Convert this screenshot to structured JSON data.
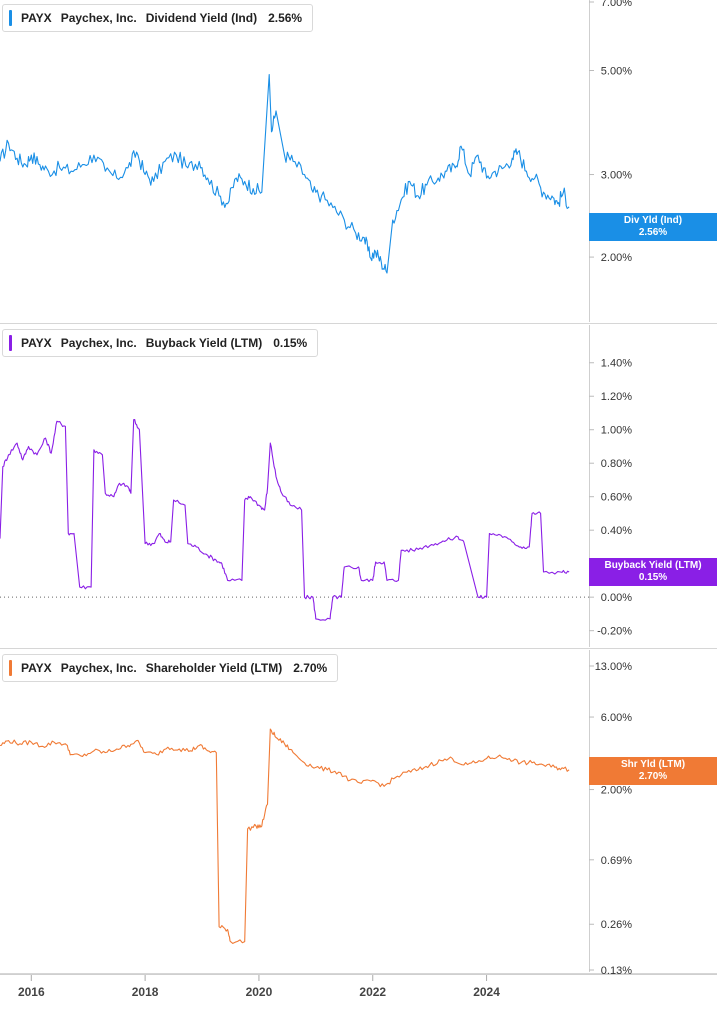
{
  "chart_data": [
    {
      "type": "line",
      "legend": {
        "ticker": "PAYX",
        "company": "Paychex, Inc.",
        "metric": "Dividend Yield (Ind)",
        "value": "2.56%"
      },
      "tag": {
        "label": "Div Yld (Ind)",
        "value": "2.56%"
      },
      "color": "#1a8fe6",
      "scale": "log",
      "ylim": [
        1.62,
        7.0
      ],
      "yticks": [
        {
          "label": "7.00%",
          "v": 7.0
        },
        {
          "label": "5.00%",
          "v": 5.0
        },
        {
          "label": "3.00%",
          "v": 3.0
        },
        {
          "label": "2.00%",
          "v": 2.0
        }
      ],
      "zero_line": false,
      "series": [
        {
          "points": [
            [
              2015.45,
              3.2
            ],
            [
              2015.6,
              3.5
            ],
            [
              2015.75,
              3.25
            ],
            [
              2015.9,
              3.15
            ],
            [
              2016.0,
              3.3
            ],
            [
              2016.15,
              3.15
            ],
            [
              2016.3,
              3.05
            ],
            [
              2016.5,
              3.1
            ],
            [
              2016.7,
              3.05
            ],
            [
              2016.9,
              3.15
            ],
            [
              2017.1,
              3.3
            ],
            [
              2017.3,
              3.05
            ],
            [
              2017.5,
              2.95
            ],
            [
              2017.7,
              3.1
            ],
            [
              2017.85,
              3.35
            ],
            [
              2018.0,
              3.0
            ],
            [
              2018.15,
              2.9
            ],
            [
              2018.35,
              3.2
            ],
            [
              2018.55,
              3.3
            ],
            [
              2018.75,
              3.1
            ],
            [
              2018.95,
              3.2
            ],
            [
              2019.1,
              2.95
            ],
            [
              2019.3,
              2.7
            ],
            [
              2019.45,
              2.6
            ],
            [
              2019.6,
              2.95
            ],
            [
              2019.75,
              2.9
            ],
            [
              2019.9,
              2.8
            ],
            [
              2020.05,
              2.75
            ],
            [
              2020.18,
              4.9
            ],
            [
              2020.22,
              3.7
            ],
            [
              2020.3,
              4.1
            ],
            [
              2020.45,
              3.3
            ],
            [
              2020.6,
              3.2
            ],
            [
              2020.8,
              3.0
            ],
            [
              2020.95,
              2.75
            ],
            [
              2021.1,
              2.7
            ],
            [
              2021.3,
              2.55
            ],
            [
              2021.5,
              2.4
            ],
            [
              2021.7,
              2.25
            ],
            [
              2021.85,
              2.2
            ],
            [
              2021.95,
              2.0
            ],
            [
              2022.05,
              2.05
            ],
            [
              2022.15,
              1.95
            ],
            [
              2022.25,
              1.85
            ],
            [
              2022.35,
              2.4
            ],
            [
              2022.5,
              2.65
            ],
            [
              2022.65,
              2.9
            ],
            [
              2022.8,
              2.7
            ],
            [
              2022.95,
              2.85
            ],
            [
              2023.15,
              2.95
            ],
            [
              2023.3,
              3.05
            ],
            [
              2023.45,
              3.1
            ],
            [
              2023.55,
              3.45
            ],
            [
              2023.7,
              3.0
            ],
            [
              2023.85,
              3.3
            ],
            [
              2024.0,
              2.95
            ],
            [
              2024.15,
              3.05
            ],
            [
              2024.3,
              3.1
            ],
            [
              2024.45,
              3.25
            ],
            [
              2024.55,
              3.35
            ],
            [
              2024.7,
              3.05
            ],
            [
              2024.85,
              2.95
            ],
            [
              2025.0,
              2.75
            ],
            [
              2025.15,
              2.7
            ],
            [
              2025.25,
              2.6
            ],
            [
              2025.35,
              2.75
            ],
            [
              2025.45,
              2.56
            ]
          ]
        }
      ]
    },
    {
      "type": "line",
      "legend": {
        "ticker": "PAYX",
        "company": "Paychex, Inc.",
        "metric": "Buyback Yield (LTM)",
        "value": "0.15%"
      },
      "tag": {
        "label": "Buyback Yield (LTM)",
        "value": "0.15%"
      },
      "color": "#8a1fe6",
      "scale": "linear",
      "ylim": [
        -0.22,
        1.5
      ],
      "yticks": [
        {
          "label": "1.40%",
          "v": 1.4
        },
        {
          "label": "1.20%",
          "v": 1.2
        },
        {
          "label": "1.00%",
          "v": 1.0
        },
        {
          "label": "0.80%",
          "v": 0.8
        },
        {
          "label": "0.60%",
          "v": 0.6
        },
        {
          "label": "0.40%",
          "v": 0.4
        },
        {
          "label": "0.20%",
          "v": 0.2
        },
        {
          "label": "0.00%",
          "v": 0.0
        },
        {
          "label": "-0.20%",
          "v": -0.2
        }
      ],
      "zero_line": true,
      "series": [
        {
          "points": [
            [
              2015.45,
              0.35
            ],
            [
              2015.5,
              0.78
            ],
            [
              2015.6,
              0.85
            ],
            [
              2015.75,
              0.92
            ],
            [
              2015.85,
              0.82
            ],
            [
              2015.95,
              0.9
            ],
            [
              2016.1,
              0.85
            ],
            [
              2016.25,
              0.95
            ],
            [
              2016.35,
              0.86
            ],
            [
              2016.45,
              1.05
            ],
            [
              2016.6,
              1.02
            ],
            [
              2016.65,
              0.38
            ],
            [
              2016.75,
              0.38
            ],
            [
              2016.85,
              0.06
            ],
            [
              2017.05,
              0.06
            ],
            [
              2017.1,
              0.88
            ],
            [
              2017.25,
              0.85
            ],
            [
              2017.3,
              0.62
            ],
            [
              2017.45,
              0.6
            ],
            [
              2017.55,
              0.68
            ],
            [
              2017.7,
              0.66
            ],
            [
              2017.75,
              0.62
            ],
            [
              2017.8,
              1.06
            ],
            [
              2017.9,
              1.0
            ],
            [
              2018.0,
              0.32
            ],
            [
              2018.15,
              0.32
            ],
            [
              2018.25,
              0.38
            ],
            [
              2018.35,
              0.33
            ],
            [
              2018.45,
              0.33
            ],
            [
              2018.5,
              0.58
            ],
            [
              2018.7,
              0.55
            ],
            [
              2018.75,
              0.32
            ],
            [
              2018.9,
              0.3
            ],
            [
              2019.1,
              0.25
            ],
            [
              2019.25,
              0.22
            ],
            [
              2019.35,
              0.2
            ],
            [
              2019.45,
              0.1
            ],
            [
              2019.7,
              0.1
            ],
            [
              2019.75,
              0.58
            ],
            [
              2019.85,
              0.6
            ],
            [
              2020.0,
              0.55
            ],
            [
              2020.1,
              0.52
            ],
            [
              2020.15,
              0.65
            ],
            [
              2020.2,
              0.92
            ],
            [
              2020.3,
              0.72
            ],
            [
              2020.4,
              0.62
            ],
            [
              2020.55,
              0.55
            ],
            [
              2020.75,
              0.52
            ],
            [
              2020.8,
              0.0
            ],
            [
              2020.95,
              0.0
            ],
            [
              2021.0,
              -0.13
            ],
            [
              2021.25,
              -0.13
            ],
            [
              2021.3,
              0.0
            ],
            [
              2021.45,
              0.0
            ],
            [
              2021.5,
              0.18
            ],
            [
              2021.75,
              0.18
            ],
            [
              2021.8,
              0.1
            ],
            [
              2022.0,
              0.1
            ],
            [
              2022.05,
              0.21
            ],
            [
              2022.2,
              0.21
            ],
            [
              2022.25,
              0.1
            ],
            [
              2022.45,
              0.1
            ],
            [
              2022.5,
              0.28
            ],
            [
              2022.7,
              0.28
            ],
            [
              2022.9,
              0.3
            ],
            [
              2023.1,
              0.32
            ],
            [
              2023.3,
              0.34
            ],
            [
              2023.5,
              0.36
            ],
            [
              2023.6,
              0.33
            ],
            [
              2023.85,
              0.0
            ],
            [
              2024.0,
              0.0
            ],
            [
              2024.05,
              0.38
            ],
            [
              2024.25,
              0.37
            ],
            [
              2024.45,
              0.33
            ],
            [
              2024.6,
              0.3
            ],
            [
              2024.75,
              0.3
            ],
            [
              2024.8,
              0.5
            ],
            [
              2024.95,
              0.5
            ],
            [
              2025.0,
              0.15
            ],
            [
              2025.3,
              0.15
            ],
            [
              2025.45,
              0.15
            ]
          ]
        }
      ]
    },
    {
      "type": "line",
      "legend": {
        "ticker": "PAYX",
        "company": "Paychex, Inc.",
        "metric": "Shareholder Yield (LTM)",
        "value": "2.70%"
      },
      "tag": {
        "label": "Shr Yld (LTM)",
        "value": "2.70%"
      },
      "color": "#f07a35",
      "scale": "log",
      "ylim": [
        0.13,
        13.0
      ],
      "yticks": [
        {
          "label": "13.00%",
          "v": 13.0
        },
        {
          "label": "6.00%",
          "v": 6.0
        },
        {
          "label": "2.00%",
          "v": 2.0
        },
        {
          "label": "0.69%",
          "v": 0.69
        },
        {
          "label": "0.26%",
          "v": 0.26
        },
        {
          "label": "0.13%",
          "v": 0.13
        }
      ],
      "zero_line": false,
      "series": [
        {
          "points": [
            [
              2015.45,
              3.9
            ],
            [
              2015.6,
              4.2
            ],
            [
              2015.8,
              4.0
            ],
            [
              2016.0,
              4.1
            ],
            [
              2016.2,
              3.85
            ],
            [
              2016.4,
              4.1
            ],
            [
              2016.6,
              4.0
            ],
            [
              2016.7,
              3.4
            ],
            [
              2016.9,
              3.3
            ],
            [
              2017.1,
              3.6
            ],
            [
              2017.3,
              3.5
            ],
            [
              2017.5,
              3.7
            ],
            [
              2017.7,
              3.9
            ],
            [
              2017.85,
              4.2
            ],
            [
              2018.0,
              3.5
            ],
            [
              2018.2,
              3.4
            ],
            [
              2018.4,
              3.8
            ],
            [
              2018.6,
              3.7
            ],
            [
              2018.8,
              3.6
            ],
            [
              2018.95,
              3.9
            ],
            [
              2019.1,
              3.6
            ],
            [
              2019.25,
              3.5
            ],
            [
              2019.3,
              0.25
            ],
            [
              2019.45,
              0.24
            ],
            [
              2019.5,
              0.2
            ],
            [
              2019.75,
              0.2
            ],
            [
              2019.8,
              1.1
            ],
            [
              2019.95,
              1.15
            ],
            [
              2020.05,
              1.15
            ],
            [
              2020.15,
              1.6
            ],
            [
              2020.2,
              5.0
            ],
            [
              2020.3,
              4.4
            ],
            [
              2020.45,
              4.0
            ],
            [
              2020.6,
              3.5
            ],
            [
              2020.8,
              3.0
            ],
            [
              2021.0,
              2.8
            ],
            [
              2021.2,
              2.7
            ],
            [
              2021.4,
              2.6
            ],
            [
              2021.6,
              2.3
            ],
            [
              2021.8,
              2.2
            ],
            [
              2022.0,
              2.3
            ],
            [
              2022.2,
              2.1
            ],
            [
              2022.4,
              2.4
            ],
            [
              2022.6,
              2.6
            ],
            [
              2022.8,
              2.7
            ],
            [
              2023.0,
              2.9
            ],
            [
              2023.2,
              3.1
            ],
            [
              2023.4,
              3.2
            ],
            [
              2023.6,
              2.9
            ],
            [
              2023.8,
              3.0
            ],
            [
              2024.0,
              3.2
            ],
            [
              2024.2,
              3.3
            ],
            [
              2024.4,
              3.2
            ],
            [
              2024.6,
              3.0
            ],
            [
              2024.8,
              3.0
            ],
            [
              2025.0,
              2.9
            ],
            [
              2025.2,
              2.8
            ],
            [
              2025.35,
              2.75
            ],
            [
              2025.45,
              2.7
            ]
          ]
        }
      ]
    }
  ],
  "x_axis": {
    "range": [
      2015.45,
      2025.8
    ],
    "ticks": [
      {
        "label": "2016",
        "v": 2016
      },
      {
        "label": "2018",
        "v": 2018
      },
      {
        "label": "2020",
        "v": 2020
      },
      {
        "label": "2022",
        "v": 2022
      },
      {
        "label": "2024",
        "v": 2024
      }
    ]
  }
}
